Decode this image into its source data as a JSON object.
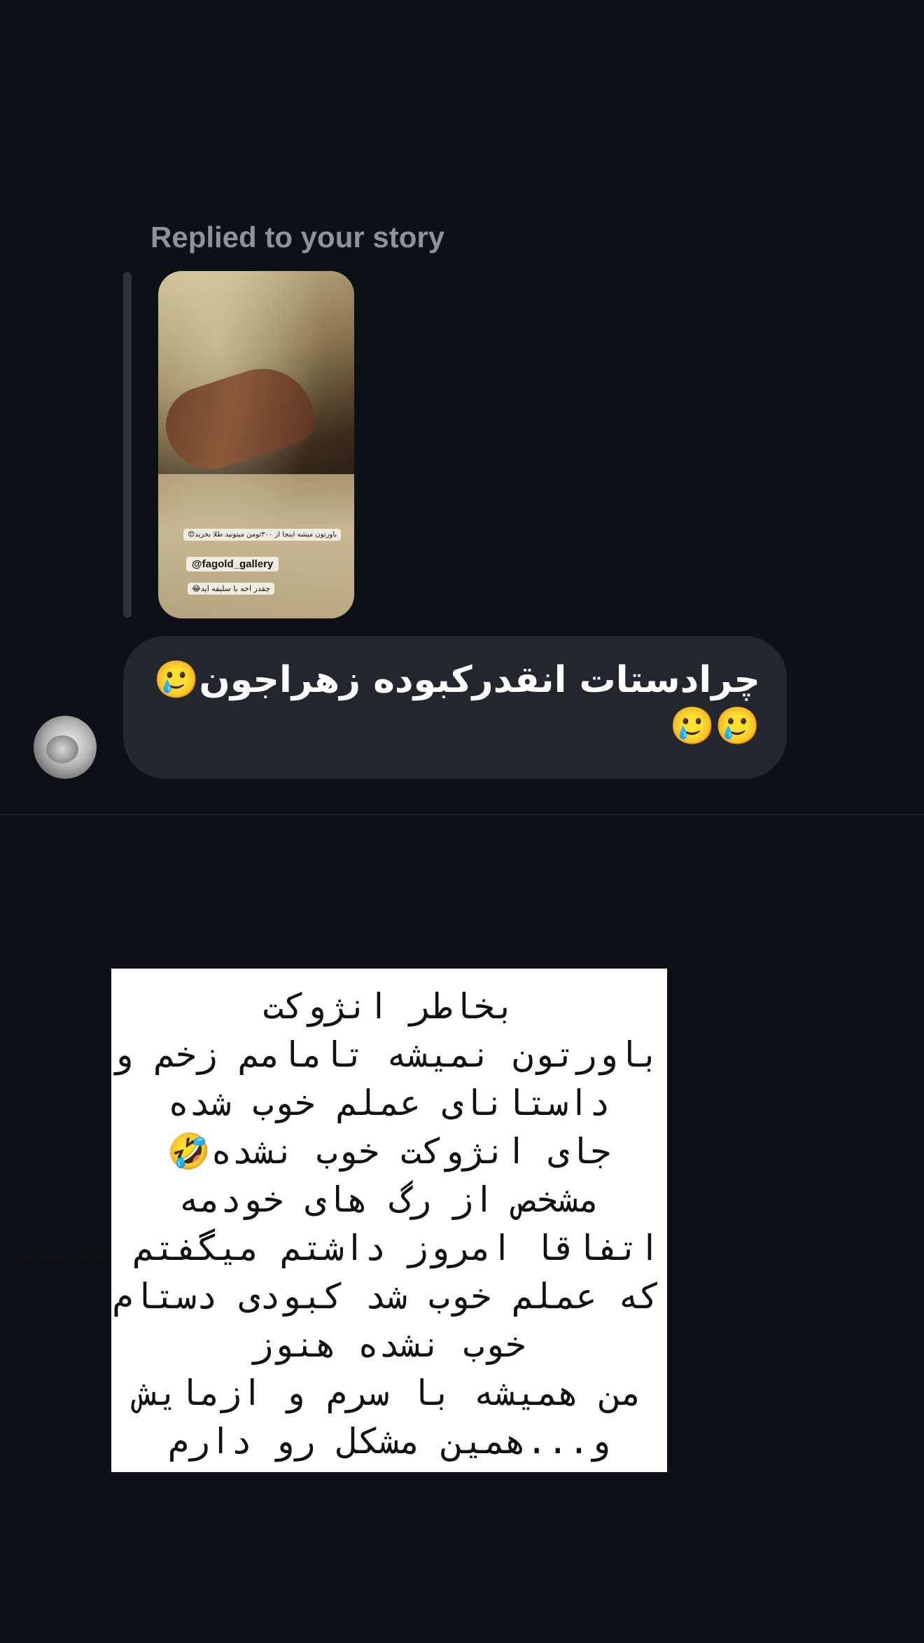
{
  "reply_header": {
    "label": "Replied to your story"
  },
  "story_thumbnail": {
    "caption_price": "باورتون میشه اینجا از ۳۰۰تومن میتونید طلا بخرید😍",
    "caption_mention": "@fagold_gallery",
    "caption_bottom": "چقدر اخه با سلیقه اید😂"
  },
  "message": {
    "text": "چرادستات انقدرکبوده زهراجون🥲🥲🥲"
  },
  "story_text": {
    "lines": [
      "بخاطر انژوکت",
      "باورتون نمیشه تامامم زخم و",
      "داستانای عملم خوب شده",
      "جای انژوکت خوب نشده🤣",
      "مشخص از رگ های خودمه",
      "اتفاقا امروز داشتم میگفتم همینو",
      "که عملم خوب شد کبودی دستام",
      "خوب نشده هنوز",
      "من همیشه با سرم و ازمایش",
      "و...همین مشکل رو دارم"
    ]
  },
  "colors": {
    "background": "#0d1016",
    "bubble": "#23262d",
    "reply_label": "#8e9299",
    "quote_bar": "#2e3138",
    "story_card": "#ffffff"
  }
}
